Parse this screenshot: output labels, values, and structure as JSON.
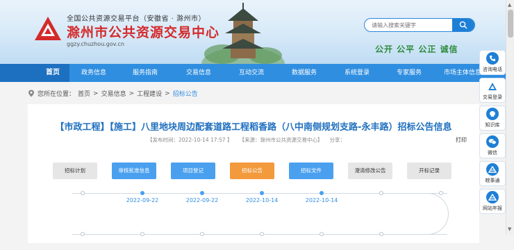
{
  "header": {
    "org_line": "全国公共资源交易平台（安徽省 · 滁州市）",
    "title": "滁州市公共资源交易中心",
    "url": "ggzy.chuzhou.gov.cn",
    "slogan": "公开 公平 公正 诚信"
  },
  "search": {
    "placeholder": "请输入搜索关键字"
  },
  "nav": {
    "items": [
      {
        "label": "首页",
        "active": true
      },
      {
        "label": "政务信息"
      },
      {
        "label": "服务指南"
      },
      {
        "label": "交易信息"
      },
      {
        "label": "互动交流"
      },
      {
        "label": "数据服务"
      },
      {
        "label": "系统登录"
      },
      {
        "label": "专家服务"
      },
      {
        "label": "市场主体信息"
      }
    ]
  },
  "breadcrumb": {
    "prefix": "您所在位置：",
    "home": "首页",
    "sep": ">",
    "level1": "交易信息",
    "level2": "工程建设",
    "current": "招标公告"
  },
  "article": {
    "title": "【市政工程】【施工】八里地块周边配套道路工程稻香路（八中南侧规划支路-永丰路）招标公告信息",
    "publish_time": "【发布时间：2022-10-14 17:57 】",
    "source": "【来源：滁州市公共资源交易中心】",
    "share": "分享：",
    "print": "打印"
  },
  "steps": [
    {
      "label": "招标计划",
      "state": "grey"
    },
    {
      "label": "审核批准信息",
      "state": "blue"
    },
    {
      "label": "项目登记",
      "state": "blue"
    },
    {
      "label": "招标公告",
      "state": "orange"
    },
    {
      "label": "招标文件",
      "state": "blue"
    },
    {
      "label": "澄清修改公告",
      "state": "grey"
    },
    {
      "label": "开标记录",
      "state": "grey"
    }
  ],
  "timeline_dates": [
    "2022-09-22",
    "2022-09-22",
    "2022-10-14",
    "2022-10-14"
  ],
  "sidebar": {
    "items": [
      {
        "label": "咨询电话",
        "icon": "phone-icon"
      },
      {
        "label": "交易登录",
        "icon": "login-icon"
      },
      {
        "label": "知识库",
        "icon": "knowledge-icon"
      },
      {
        "label": "微信",
        "icon": "wechat-icon"
      },
      {
        "label": "皖事通",
        "icon": "wanshitong-icon"
      },
      {
        "label": "网站年报",
        "icon": "report-icon"
      }
    ]
  },
  "colors": {
    "nav_bg": "#2f8ee0",
    "nav_active": "#1d6fc0",
    "title_red": "#d42a2a",
    "title_blue": "#1f6fbf",
    "step_blue": "#4aa0ef",
    "step_orange": "#f29a3c",
    "slogan_green": "#2c8a3c"
  }
}
